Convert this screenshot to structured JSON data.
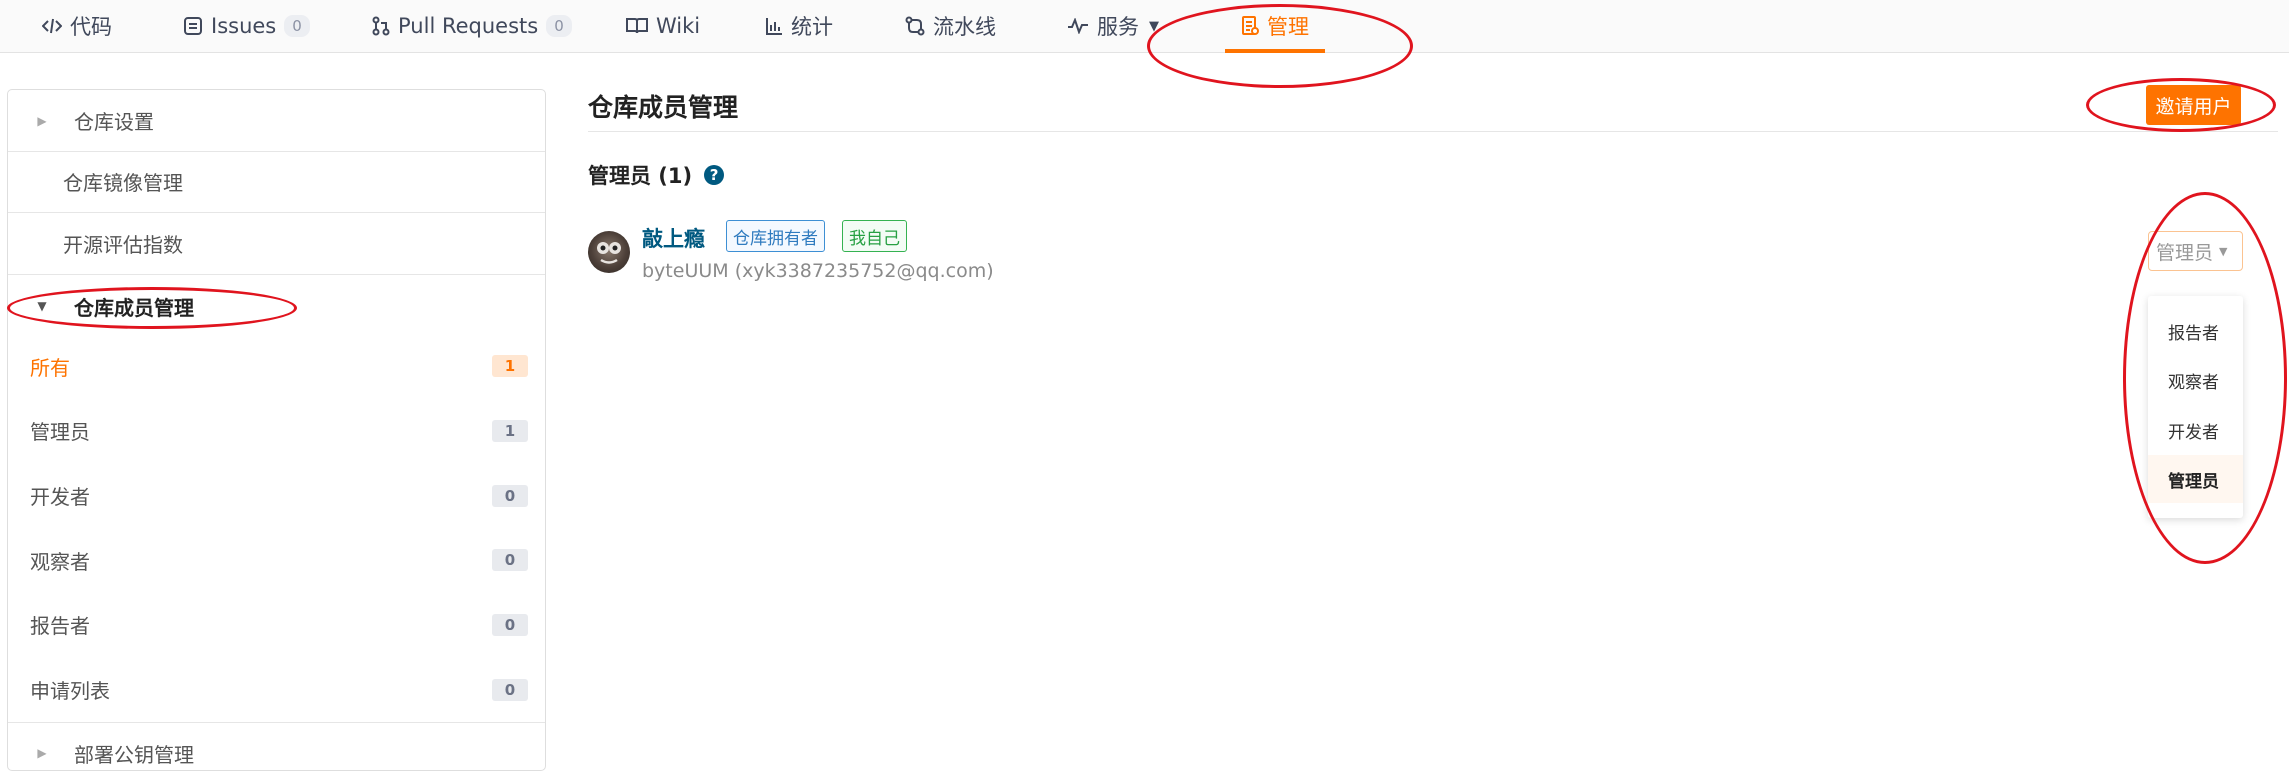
{
  "nav": {
    "tabs": [
      {
        "label": "代码",
        "icon": "code-icon"
      },
      {
        "label": "Issues",
        "icon": "issues-icon",
        "count": "0"
      },
      {
        "label": "Pull Requests",
        "icon": "pull-request-icon",
        "count": "0"
      },
      {
        "label": "Wiki",
        "icon": "wiki-icon"
      },
      {
        "label": "统计",
        "icon": "chart-icon"
      },
      {
        "label": "流水线",
        "icon": "pipeline-icon"
      },
      {
        "label": "服务",
        "icon": "service-icon"
      },
      {
        "label": "管理",
        "icon": "manage-icon"
      }
    ],
    "active_tab": "管理",
    "accent": "#fe7300"
  },
  "sidebar": {
    "groups": [
      {
        "label": "仓库设置"
      },
      {
        "label": "仓库镜像管理"
      },
      {
        "label": "开源评估指数"
      },
      {
        "label": "仓库成员管理"
      }
    ],
    "members_filter": [
      {
        "label": "所有",
        "count": "1"
      },
      {
        "label": "管理员",
        "count": "1"
      },
      {
        "label": "开发者",
        "count": "0"
      },
      {
        "label": "观察者",
        "count": "0"
      },
      {
        "label": "报告者",
        "count": "0"
      },
      {
        "label": "申请列表",
        "count": "0"
      }
    ],
    "next_group": "部署公钥管理"
  },
  "main": {
    "title": "仓库成员管理",
    "invite_label": "邀请用户",
    "section_title": "管理员 (1)",
    "member": {
      "name": "敲上瘾",
      "tag_owner": "仓库拥有者",
      "tag_self": "我自己",
      "subtitle": "byteUUM (xyk3387235752@qq.com)",
      "role": "管理员"
    },
    "role_options": [
      "报告者",
      "观察者",
      "开发者",
      "管理员"
    ]
  }
}
